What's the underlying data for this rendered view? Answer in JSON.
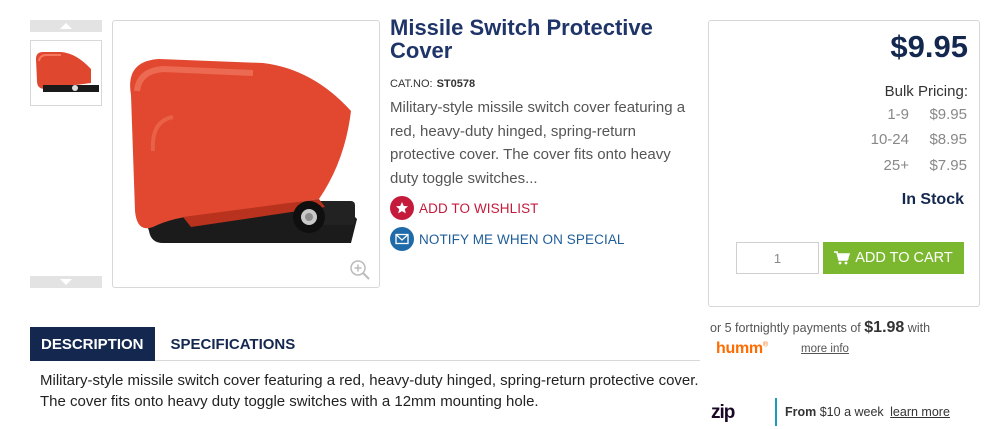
{
  "product": {
    "title": "Missile Switch Protective Cover",
    "catno_label": "CAT.NO:",
    "catno_value": "ST0578",
    "short_description": "Military-style missile switch cover featuring a red, heavy-duty hinged, spring-return protective cover. The cover fits onto heavy duty toggle switches..."
  },
  "actions": {
    "wishlist_label": "ADD TO WISHLIST",
    "notify_label": "NOTIFY ME WHEN ON SPECIAL"
  },
  "tabs": [
    {
      "label": "DESCRIPTION",
      "active": true
    },
    {
      "label": "SPECIFICATIONS",
      "active": false
    }
  ],
  "description_text": "Military-style missile switch cover featuring a red, heavy-duty hinged, spring-return protective cover. The cover fits onto heavy duty toggle switches with a 12mm mounting hole.",
  "pricing": {
    "price": "$9.95",
    "bulk_title": "Bulk Pricing:",
    "tiers": [
      {
        "qty": "1-9",
        "price": "$9.95"
      },
      {
        "qty": "10-24",
        "price": "$8.95"
      },
      {
        "qty": "25+",
        "price": "$7.95"
      }
    ],
    "stock_status": "In Stock",
    "quantity_value": "1",
    "add_to_cart_label": "ADD TO CART"
  },
  "humm": {
    "prefix": "or 5 fortnightly payments of",
    "amount": "$1.98",
    "suffix": "with",
    "logo": "humm",
    "more_info": "more info"
  },
  "zip": {
    "logo": "zip",
    "from_label": "From",
    "amount_text": "$10 a week",
    "learn_more": "learn more"
  },
  "colors": {
    "brand_navy": "#14284f",
    "wishlist_red": "#c41a3b",
    "notify_blue": "#1f6aa8",
    "cart_green": "#7cb82f",
    "humm_orange": "#ff6c00",
    "zip_teal": "#1a9bb8"
  },
  "icons": [
    "chevron-up-icon",
    "chevron-down-icon",
    "zoom-icon",
    "star-icon",
    "envelope-icon",
    "cart-icon"
  ]
}
